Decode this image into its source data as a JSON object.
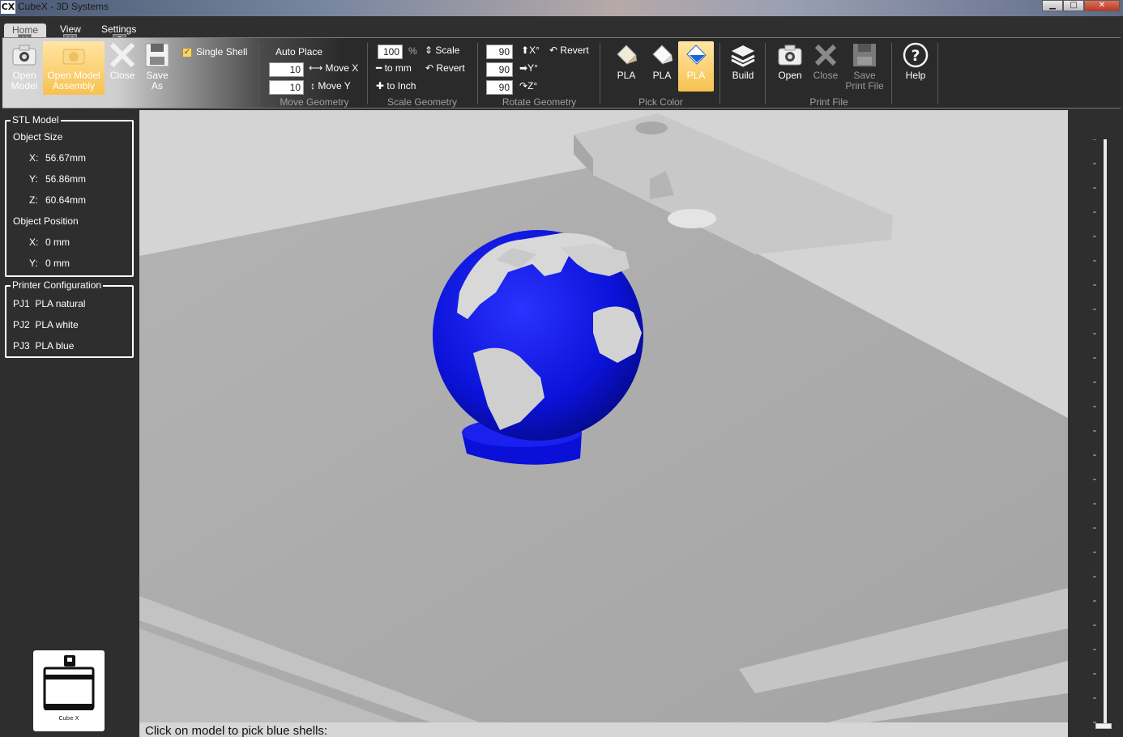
{
  "window": {
    "title": "CubeX - 3D Systems",
    "icon_label": "CX",
    "minimize": "▁",
    "maximize": "□",
    "close": "✕"
  },
  "tabs": [
    {
      "label": "Home",
      "keytip": "H"
    },
    {
      "label": "View",
      "keytip": "V"
    },
    {
      "label": "Settings",
      "keytip": "S"
    }
  ],
  "ribbon": {
    "open_model": "Open\nModel",
    "open_model_assembly": "Open Model\nAssembly",
    "close": "Close",
    "save_as": "Save\nAs",
    "single_shell": "Single Shell",
    "single_shell_checked": true,
    "auto_place": "Auto Place",
    "move_x_value": "10",
    "move_x": "Move X",
    "move_y_value": "10",
    "move_y": "Move Y",
    "move_geometry": "Move Geometry",
    "scale_value": "100",
    "percent": "%",
    "scale": "Scale",
    "to_mm": "to mm",
    "revert_scale": "Revert",
    "to_inch": "to Inch",
    "scale_geometry": "Scale Geometry",
    "rot_x_value": "90",
    "rot_y_value": "90",
    "rot_z_value": "90",
    "rot_x": "X°",
    "rot_y": "Y°",
    "rot_z": "Z°",
    "revert_rotate": "Revert",
    "rotate_geometry": "Rotate Geometry",
    "pla1": "PLA",
    "pla2": "PLA",
    "pla3": "PLA",
    "pick_color": "Pick Color",
    "build": "Build",
    "open_print": "Open",
    "close_print": "Close",
    "save_print_file": "Save\nPrint File",
    "print_file": "Print File",
    "help": "Help"
  },
  "stl_model": {
    "legend": "STL Model",
    "object_size": "Object Size",
    "size_x_label": "X:",
    "size_x": "56.67mm",
    "size_y_label": "Y:",
    "size_y": "56.86mm",
    "size_z_label": "Z:",
    "size_z": "60.64mm",
    "object_position": "Object Position",
    "pos_x_label": "X:",
    "pos_x": "0 mm",
    "pos_y_label": "Y:",
    "pos_y": "0 mm"
  },
  "printer_config": {
    "legend": "Printer Configuration",
    "jets": [
      {
        "id": "PJ1",
        "material": "PLA natural"
      },
      {
        "id": "PJ2",
        "material": "PLA white"
      },
      {
        "id": "PJ3",
        "material": "PLA blue"
      }
    ]
  },
  "printer_icon_label": "Cube X",
  "status_text": "Click on model to pick blue shells:",
  "colors": {
    "accent_highlight": "#f7c150",
    "model_blue": "#0a10d8",
    "panel_bg": "#2e2e2e",
    "viewport_bg": "#d3d3d3"
  }
}
